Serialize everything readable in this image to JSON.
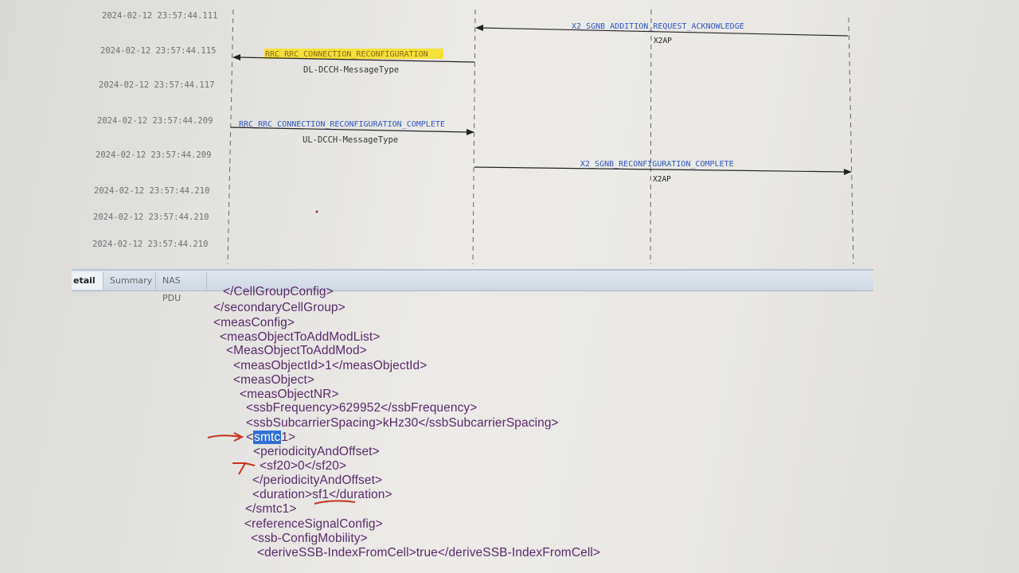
{
  "sequence": {
    "timestamps": [
      "2024-02-12 23:57:44.111",
      "2024-02-12 23:57:44.115",
      "2024-02-12 23:57:44.117",
      "2024-02-12 23:57:44.209",
      "2024-02-12 23:57:44.209",
      "2024-02-12 23:57:44.210",
      "2024-02-12 23:57:44.210",
      "2024-02-12 23:57:44.210"
    ],
    "messages": [
      {
        "label": "X2_SGNB_ADDITION_REQUEST_ACKNOWLEDGE",
        "protocol": "X2AP"
      },
      {
        "label": "RRC_RRC_CONNECTION_RECONFIGURATION",
        "sublabel": "DL-DCCH-MessageType"
      },
      {
        "label": "RRC_RRC_CONNECTION_RECONFIGURATION_COMPLETE",
        "sublabel": "UL-DCCH-MessageType"
      },
      {
        "label": "X2_SGNB_RECONFIGURATION_COMPLETE",
        "protocol": "X2AP"
      }
    ],
    "highlight_color": "#f4e13a",
    "link_color": "#2f57c4"
  },
  "tabs": [
    {
      "label": "Detail",
      "visible_text": "etail",
      "active": true
    },
    {
      "label": "Summary",
      "active": false
    },
    {
      "label": "NAS PDU",
      "active": false
    }
  ],
  "xml_lines": [
    {
      "text": "</CellGroupConfig>"
    },
    {
      "text": "</secondaryCellGroup>"
    },
    {
      "text": "<measConfig>"
    },
    {
      "text": "<measObjectToAddModList>"
    },
    {
      "text": "<MeasObjectToAddMod>"
    },
    {
      "text": "<measObjectId>1</measObjectId>"
    },
    {
      "text": "<measObject>"
    },
    {
      "text": "<measObjectNR>"
    },
    {
      "text": "<ssbFrequency>629952</ssbFrequency>"
    },
    {
      "text": "<ssbSubcarrierSpacing>kHz30</ssbSubcarrierSpacing>"
    },
    {
      "pre": "<",
      "selected": "smtc",
      "post": "1>"
    },
    {
      "text": "<periodicityAndOffset>"
    },
    {
      "text": "<sf20>0</sf20>"
    },
    {
      "text": "</periodicityAndOffset>"
    },
    {
      "text": "<duration>sf1</duration>"
    },
    {
      "text": "</smtc1>"
    },
    {
      "text": "<referenceSignalConfig>"
    },
    {
      "text": "<ssb-ConfigMobility>"
    },
    {
      "text": "<deriveSSB-IndexFromCell>true</deriveSSB-IndexFromCell>"
    }
  ],
  "colors": {
    "selection": "#2f6fd6",
    "pen_annotation": "#c8321e"
  }
}
